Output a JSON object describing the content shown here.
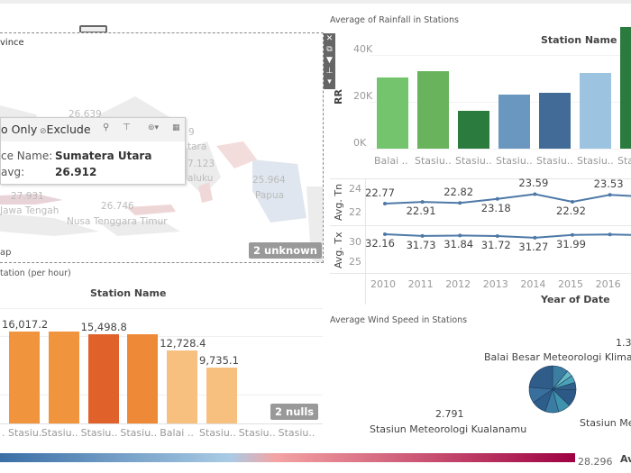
{
  "map": {
    "title": "vince",
    "labels": [
      {
        "text": "26.639"
      },
      {
        "text": "9"
      },
      {
        "text": "tara"
      },
      {
        "text": "7.123"
      },
      {
        "text": "aluku"
      },
      {
        "text": "25.964"
      },
      {
        "text": "Papua"
      },
      {
        "text": "27.931"
      },
      {
        "text": "Jawa Tengah"
      },
      {
        "text": "26.746"
      },
      {
        "text": "Nusa Tenggara Timur"
      }
    ],
    "footer": "ap",
    "unknown_badge": "2 unknown",
    "toolbar_icons": [
      "close-icon",
      "popout-icon",
      "filter-icon",
      "pin-icon",
      "dropdown-icon"
    ]
  },
  "tooltip": {
    "keep_only": "o Only",
    "exclude": "Exclude",
    "field1_label": "ce Name:",
    "field1_value": "Sumatera Utara",
    "field2_label": "avg:",
    "field2_value": "26.912"
  },
  "legend": {
    "max_value": "28.296",
    "title_fragment": "Av",
    "colors": [
      "#3a6ea5",
      "#a9cbe5",
      "#f4a3a3",
      "#9e0142"
    ]
  },
  "chart_data": [
    {
      "type": "bar",
      "title": "Average of Rainfall in Stations",
      "header": "Station Name",
      "ylabel": "RR",
      "yticks": [
        "0K",
        "20K",
        "40K"
      ],
      "ylim": [
        0,
        55000
      ],
      "categories": [
        "Balai ..",
        "Stasiu..",
        "Stasiu..",
        "Stasiu..",
        "Stasiu..",
        "Stasiu..",
        "Sta"
      ],
      "values": [
        30500,
        33000,
        16000,
        23000,
        24000,
        32500,
        52000
      ],
      "colors": [
        "#74c46d",
        "#68b35c",
        "#2b7a3e",
        "#6a97c0",
        "#436b97",
        "#9cc3e0",
        "#2b7a3e"
      ]
    },
    {
      "type": "line",
      "xlabel": "Year of Date",
      "x": [
        "2010",
        "2011",
        "2012",
        "2013",
        "2014",
        "2015",
        "2016"
      ],
      "series": [
        {
          "name": "Avg. Tn",
          "values": [
            22.77,
            22.91,
            22.82,
            23.18,
            23.59,
            22.92,
            23.53
          ],
          "yticks": [
            "22",
            "24"
          ],
          "ylim": [
            21.2,
            24.8
          ]
        },
        {
          "name": "Avg. Tx",
          "values": [
            32.16,
            31.73,
            31.84,
            31.72,
            31.27,
            31.99,
            32.1
          ],
          "labels": [
            "32.16",
            "31.73",
            "31.84",
            "31.72",
            "31.27",
            "31.99",
            ""
          ],
          "yticks": [
            "25",
            "30"
          ],
          "ylim": [
            23,
            34
          ]
        }
      ],
      "color": "#4e79a7"
    },
    {
      "type": "bar",
      "title": "tation (per hour)",
      "header": "Station Name",
      "categories": [
        ". Stasiu..",
        "Stasiu..",
        "Stasiu..",
        "Stasiu..",
        "Balai ..",
        "Stasiu..",
        "Stasiu..",
        "Stasiu.."
      ],
      "values": [
        16017.2,
        16017.2,
        15498.8,
        15498.8,
        12728.4,
        9735.1,
        null,
        null
      ],
      "labels": [
        "16,017.2",
        "",
        "15,498.8",
        "",
        "12,728.4",
        "9,735.1",
        "",
        ""
      ],
      "colors": [
        "#f0943e",
        "#f0943e",
        "#e0622a",
        "#ee8a37",
        "#f8c07f",
        "#f8c07f"
      ],
      "nulls_badge": "2 nulls"
    },
    {
      "type": "pie",
      "title": "Average Wind Speed in Stations",
      "labels": [
        {
          "value": "1.3",
          "name": "Balai Besar Meteorologi Klima"
        },
        {
          "name": "Stasiun Me"
        },
        {
          "value": "2.791",
          "name": "Stasiun Meteorologi Kualanamu"
        }
      ],
      "slices": [
        1.3,
        0.5,
        0.6,
        0.6,
        1.4,
        1.0,
        1.1,
        1.2,
        1.3,
        2.791
      ],
      "colors": [
        "#3b7ea1",
        "#66b8c4",
        "#4aa3b8",
        "#2f5f8a",
        "#2c5986",
        "#3f92ad",
        "#3a7ca3",
        "#2d5d8b",
        "#396f9c",
        "#2f5c88"
      ]
    }
  ]
}
